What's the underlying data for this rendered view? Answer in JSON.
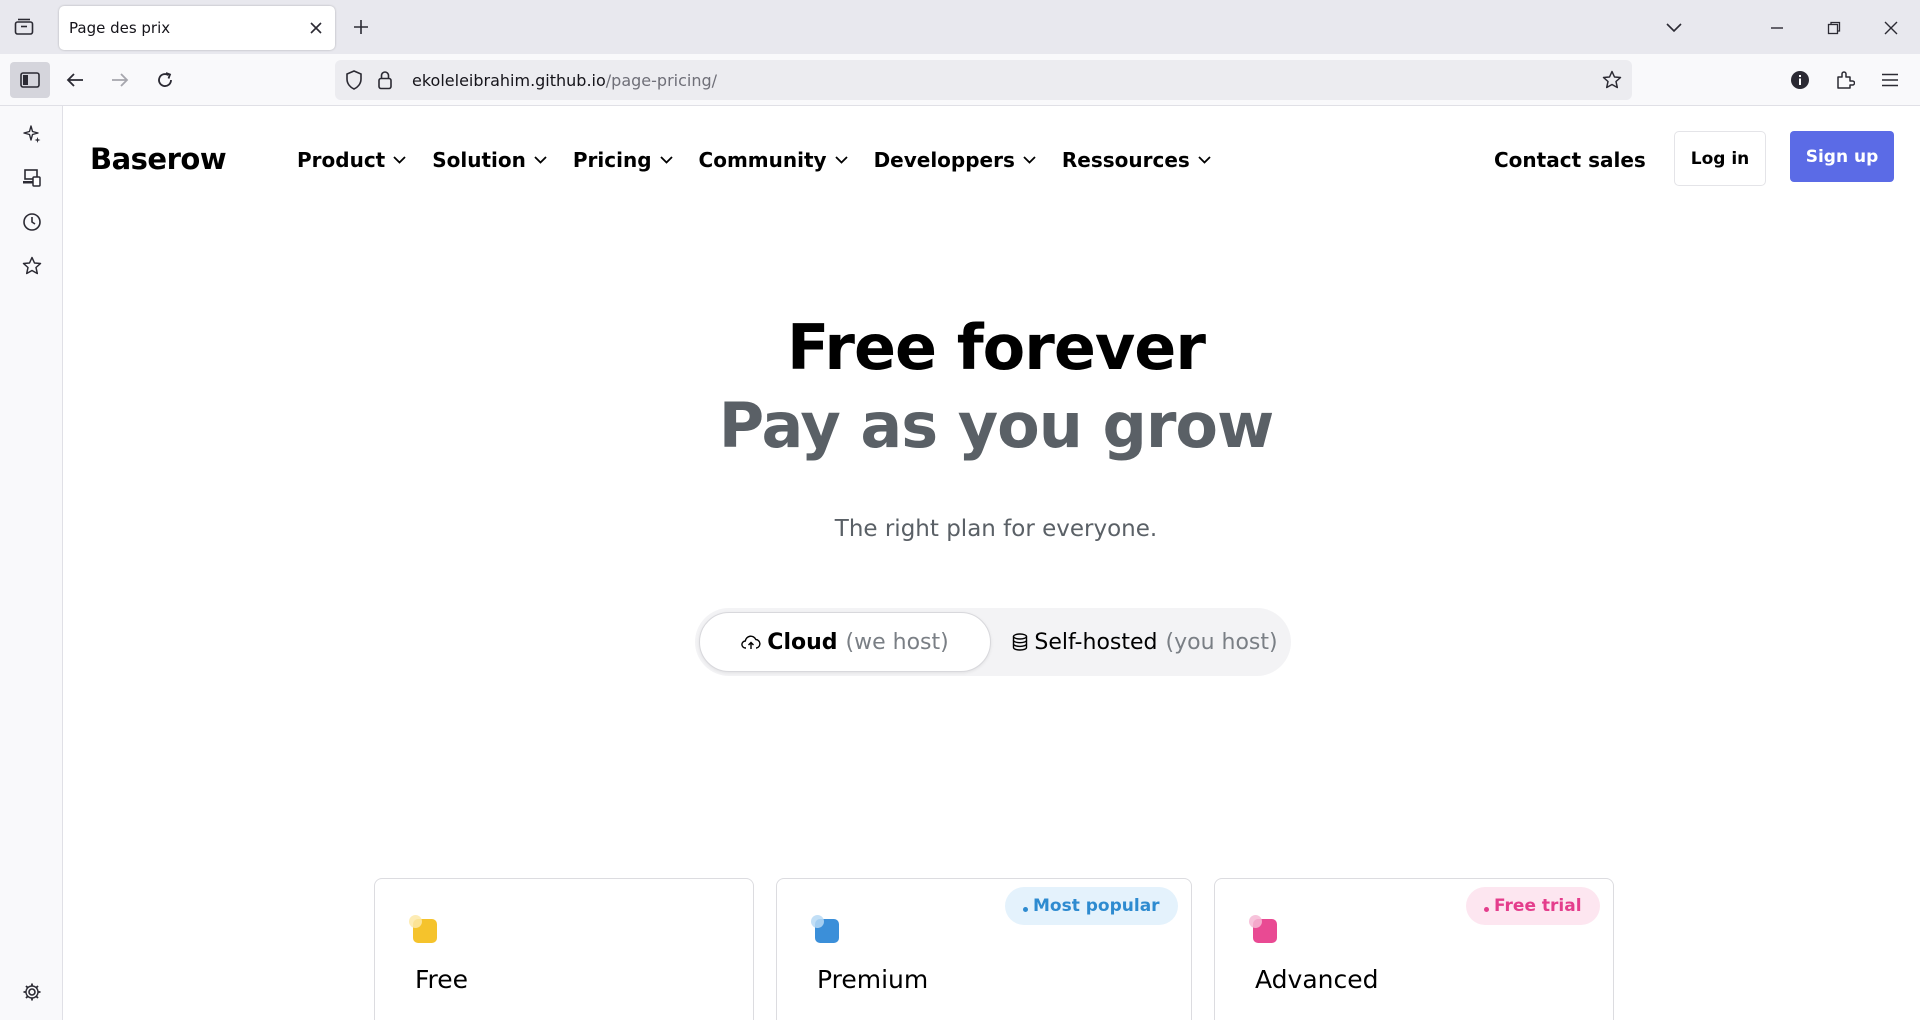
{
  "browser": {
    "tab_title": "Page des prix",
    "url_host": "ekoleleibrahim.github.io",
    "url_path": "/page-pricing/"
  },
  "nav": {
    "brand": "Baserow",
    "menu": [
      "Product",
      "Solution",
      "Pricing",
      "Community",
      "Developpers",
      "Ressources"
    ],
    "contact_sales": "Contact sales",
    "login": "Log in",
    "signup": "Sign up"
  },
  "hero": {
    "line1": "Free forever",
    "line2": "Pay as you grow",
    "subtitle": "The right plan for everyone."
  },
  "hosting_toggle": {
    "cloud_label": "Cloud",
    "cloud_note": "(we host)",
    "self_label": "Self-hosted",
    "self_note": "(you host)",
    "selected": "Cloud"
  },
  "plans": [
    {
      "name": "Free",
      "badge": "",
      "color": "#f5c32c",
      "dot": "#fde9a8"
    },
    {
      "name": "Premium",
      "badge": "Most popular",
      "color": "#3b8fd9",
      "dot": "#b7d9f5",
      "badge_bg": "#e4f2fc",
      "badge_fg": "#2e8bd0"
    },
    {
      "name": "Advanced",
      "badge": "Free trial",
      "color": "#e94a93",
      "dot": "#f6b8d5",
      "badge_bg": "#fde6f0",
      "badge_fg": "#e43d8c"
    }
  ],
  "colors": {
    "signup_bg": "#5b6be6",
    "hero_secondary": "#5a6066"
  }
}
